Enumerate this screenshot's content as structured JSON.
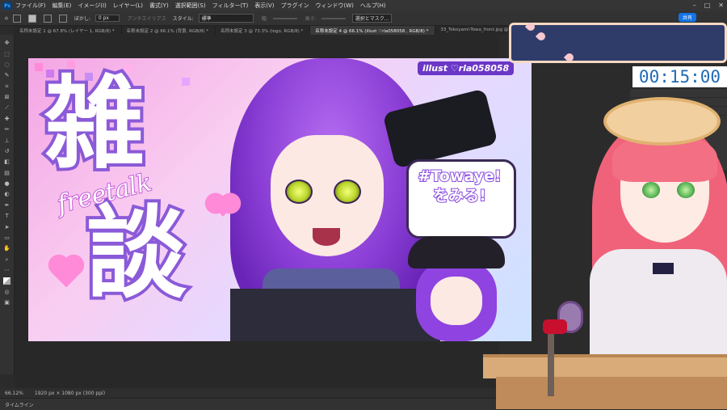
{
  "menubar": {
    "items": [
      "ファイル(F)",
      "編集(E)",
      "イメージ(I)",
      "レイヤー(L)",
      "書式(Y)",
      "選択範囲(S)",
      "フィルター(T)",
      "表示(V)",
      "プラグイン",
      "ウィンドウ(W)",
      "ヘルプ(H)"
    ],
    "share": "共有"
  },
  "options_bar": {
    "feather_label": "ぼかし:",
    "feather_value": "0 px",
    "antialias": "アンチエイリアス",
    "style_label": "スタイル:",
    "style_value": "標準",
    "width_label": "幅:",
    "height_label": "高さ:",
    "select_mask": "選択とマスク..."
  },
  "tabs": [
    "名称未設定 1 @ 67.8% (レイヤー 1, RGB/8) *",
    "名称未設定 2 @ 66.1% (背景, RGB/8) *",
    "名称未設定 3 @ 73.3% (logo, RGB/8) *",
    "名称未設定 4 @ 66.1% (illust ♡rla058058 , RGB/8) *",
    "33_Tokoyami-Towa_front.jpg @"
  ],
  "artwork": {
    "credit": "illust ♡rla058058",
    "kanji_top": "雑",
    "kanji_bottom": "談",
    "script_text": "freetalk",
    "bubble_line1": "#Towaye!",
    "bubble_line2": "をみる!"
  },
  "status": {
    "zoom": "66.12%",
    "doc_info": "1920 px × 1080 px (300 ppi)"
  },
  "timeline_label": "タイムライン",
  "timer": "00:15:00",
  "colors": {
    "ps_dark": "#2b2b2b",
    "accent_blue": "#1473e6",
    "art_purple": "#8a5ad8",
    "timer_blue": "#1f6bb7"
  }
}
